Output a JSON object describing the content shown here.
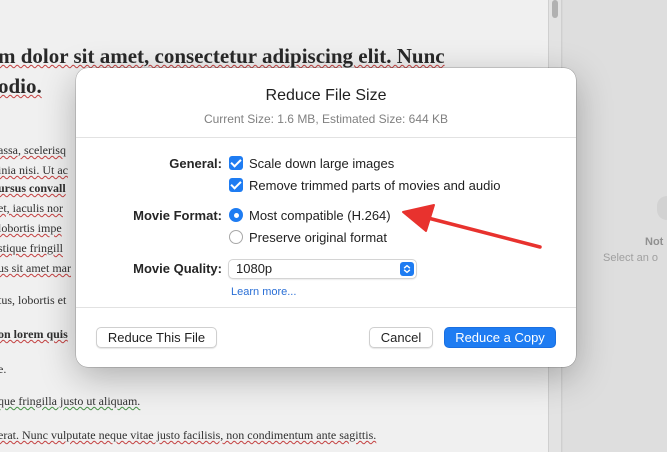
{
  "document": {
    "heading_lines": [
      "m dolor sit amet, consectetur adipiscing elit. Nunc",
      "odio."
    ],
    "body_lines": [
      {
        "text": "assa, scelerisq",
        "bold": false
      },
      {
        "text": "inia nisi. Ut ac",
        "bold": false
      },
      {
        "text": "ursus convall",
        "bold": true
      },
      {
        "text": "et, iaculis nor",
        "bold": false
      },
      {
        "text": "lobortis impe",
        "bold": false
      },
      {
        "text": "stique fringill",
        "bold": false
      },
      {
        "text": "us sit amet mar",
        "bold": false
      },
      {
        "text": "tus, lobortis et",
        "bold": false
      },
      {
        "text": "on lorem quis",
        "bold": true
      },
      {
        "text": "e.",
        "bold": false
      },
      {
        "text": "que fringilla justo ut aliquam.",
        "bold": false
      },
      {
        "text": "erat. Nunc vulputate neque vitae justo facilisis, non condimentum ante sagittis.",
        "bold": false
      }
    ]
  },
  "sidebar": {
    "title_fragment": "Not",
    "hint_fragment": "Select an o"
  },
  "dialog": {
    "title": "Reduce File Size",
    "subtitle": "Current Size: 1.6 MB, Estimated Size: 644 KB",
    "general": {
      "label": "General:",
      "options": [
        {
          "label": "Scale down large images",
          "checked": true
        },
        {
          "label": "Remove trimmed parts of movies and audio",
          "checked": true
        }
      ]
    },
    "movie_format": {
      "label": "Movie Format:",
      "options": [
        {
          "label": "Most compatible (H.264)",
          "selected": true
        },
        {
          "label": "Preserve original format",
          "selected": false
        }
      ]
    },
    "movie_quality": {
      "label": "Movie Quality:",
      "value": "1080p",
      "learn_more": "Learn more..."
    },
    "buttons": {
      "reduce_this_file": "Reduce This File",
      "cancel": "Cancel",
      "reduce_a_copy": "Reduce a Copy"
    }
  },
  "colors": {
    "accent": "#1e7cf2",
    "annotation_arrow": "#e8322e",
    "link": "#2a6fd6"
  }
}
